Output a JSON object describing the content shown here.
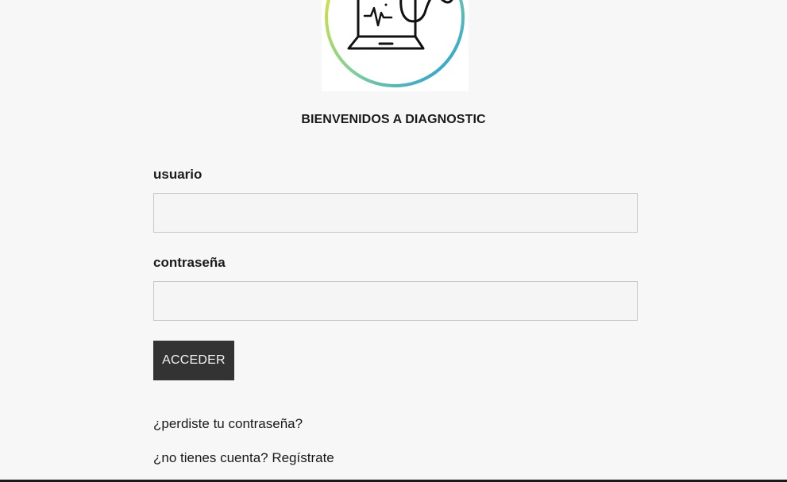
{
  "brand": {
    "logo_icon": "laptop-stethoscope-icon",
    "ring_colors": [
      "#f1e820",
      "#7fcf9a",
      "#1a9be0"
    ]
  },
  "welcome": "BIENVENIDOS A DIAGNOSTIC",
  "form": {
    "username_label": "usuario",
    "username_value": "",
    "password_label": "contraseña",
    "password_value": "",
    "submit_label": "ACCEDER"
  },
  "links": {
    "lost_password": "¿perdiste tu contraseña?",
    "register": "¿no tienes cuenta? Regístrate"
  }
}
